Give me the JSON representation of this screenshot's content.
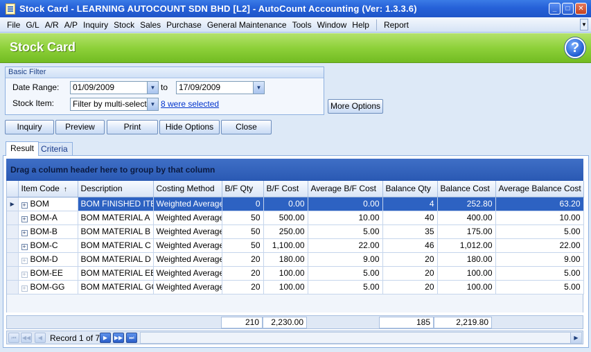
{
  "window": {
    "title": "Stock Card - LEARNING AUTOCOUNT SDN BHD [L2] - AutoCount Accounting (Ver: 1.3.3.6)",
    "minimize_glyph": "_",
    "maximize_glyph": "□",
    "close_glyph": "✕"
  },
  "menu": {
    "items": [
      "File",
      "G/L",
      "A/R",
      "A/P",
      "Inquiry",
      "Stock",
      "Sales",
      "Purchase",
      "General Maintenance",
      "Tools",
      "Window",
      "Help"
    ],
    "report": "Report"
  },
  "header": {
    "title": "Stock Card",
    "help_glyph": "?"
  },
  "filter": {
    "group_label": "Basic Filter",
    "date_range_label": "Date Range:",
    "date_from": "01/09/2009",
    "to_label": "to",
    "date_to": "17/09/2009",
    "stock_item_label": "Stock Item:",
    "stock_item_mode": "Filter by multi-select",
    "selected_link": "8 were selected",
    "more_options": "More Options"
  },
  "toolbar": {
    "inquiry": "Inquiry",
    "preview": "Preview",
    "print": "Print",
    "hide_options": "Hide Options",
    "close": "Close"
  },
  "tabs": {
    "result": "Result",
    "criteria": "Criteria"
  },
  "grid": {
    "group_hint": "Drag a column header here to group by that column",
    "columns": [
      "Item Code",
      "Description",
      "Costing Method",
      "B/F Qty",
      "B/F Cost",
      "Average B/F Cost",
      "Balance Qty",
      "Balance Cost",
      "Average Balance Cost"
    ],
    "rows": [
      [
        "BOM",
        "BOM FINISHED ITEM",
        "Weighted Average",
        "0",
        "0.00",
        "0.00",
        "4",
        "252.80",
        "63.20"
      ],
      [
        "BOM-A",
        "BOM MATERIAL A",
        "Weighted Average",
        "50",
        "500.00",
        "10.00",
        "40",
        "400.00",
        "10.00"
      ],
      [
        "BOM-B",
        "BOM MATERIAL B",
        "Weighted Average",
        "50",
        "250.00",
        "5.00",
        "35",
        "175.00",
        "5.00"
      ],
      [
        "BOM-C",
        "BOM MATERIAL C",
        "Weighted Average",
        "50",
        "1,100.00",
        "22.00",
        "46",
        "1,012.00",
        "22.00"
      ],
      [
        "BOM-D",
        "BOM MATERIAL D",
        "Weighted Average",
        "20",
        "180.00",
        "9.00",
        "20",
        "180.00",
        "9.00"
      ],
      [
        "BOM-EE",
        "BOM MATERIAL EE",
        "Weighted Average",
        "20",
        "100.00",
        "5.00",
        "20",
        "100.00",
        "5.00"
      ],
      [
        "BOM-GG",
        "BOM MATERIAL GG",
        "Weighted Average",
        "20",
        "100.00",
        "5.00",
        "20",
        "100.00",
        "5.00"
      ]
    ],
    "totals": {
      "bf_qty": "210",
      "bf_cost": "2,230.00",
      "balance_qty": "185",
      "balance_cost": "2,219.80"
    }
  },
  "navigator": {
    "record_text": "Record 1 of 7"
  },
  "colors": {
    "title_bar": "#2661d8",
    "header_green": "#8ed13a",
    "selected_row": "#2d62c2"
  }
}
